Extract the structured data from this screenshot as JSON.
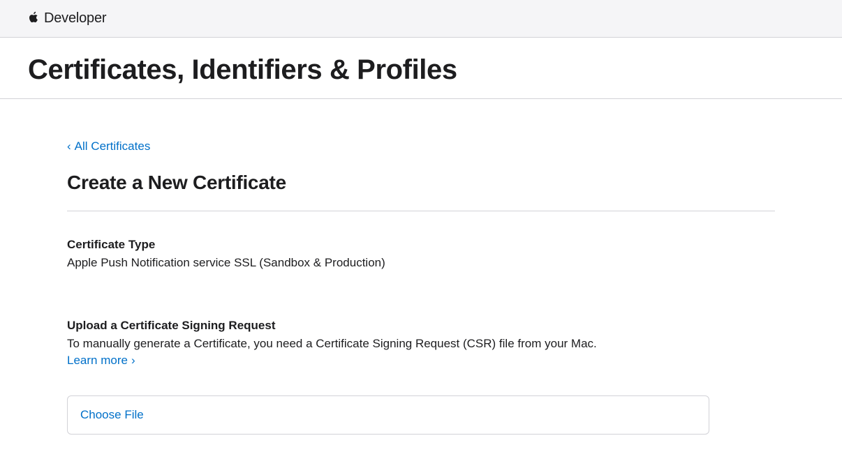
{
  "header": {
    "brand": "Developer"
  },
  "section": {
    "title": "Certificates, Identifiers & Profiles"
  },
  "nav": {
    "back_label": "All Certificates"
  },
  "page": {
    "title": "Create a New Certificate"
  },
  "cert_type": {
    "label": "Certificate Type",
    "value": "Apple Push Notification service SSL (Sandbox & Production)"
  },
  "upload": {
    "label": "Upload a Certificate Signing Request",
    "description": "To manually generate a Certificate, you need a Certificate Signing Request (CSR) file from your Mac.",
    "learn_more": "Learn more",
    "choose_file": "Choose File"
  }
}
